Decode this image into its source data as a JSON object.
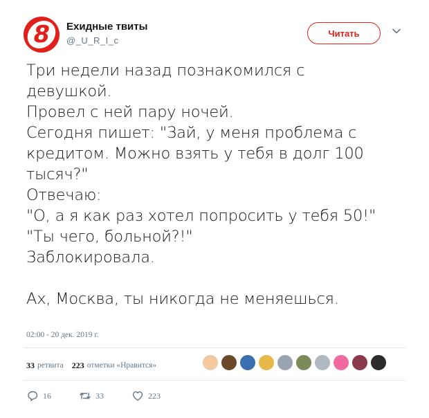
{
  "user": {
    "name": "Ехидные твиты",
    "handle": "@_U_R_I_c",
    "avatar_glyph": "8",
    "brand_color": "#e0201b"
  },
  "follow_label": "Читать",
  "tweet_lines": [
    "Три недели назад познакомился с",
    "девушкой.",
    "Провел с ней пару ночей.",
    "Сегодня пишет: \"Зай, у меня проблема с",
    "кредитом. Можно взять у тебя в долг 100",
    "тысяч?\"",
    "Отвечаю:",
    "\"О, а я как раз хотел попросить у тебя 50!\"",
    "\"Ты чего, больной?!\"",
    "Заблокировала.",
    "",
    "Ах, Москва, ты никогда не меняешься."
  ],
  "timestamp": "02:00 - 20 дек. 2019 г.",
  "stats": {
    "retweets_count": "33",
    "retweets_label": "ретвита",
    "likes_count": "223",
    "likes_label": "отметки «Нравится»"
  },
  "likers": [
    "#f2c9a0",
    "#6b4a2b",
    "#3a6fb0",
    "#e8b84a",
    "#9aa4b0",
    "#7c8b5a",
    "#b0b8c2",
    "#f06aa0",
    "#8a3a4a",
    "#2c2c2c"
  ],
  "actions": {
    "replies": "16",
    "retweets": "33",
    "likes": "223"
  }
}
